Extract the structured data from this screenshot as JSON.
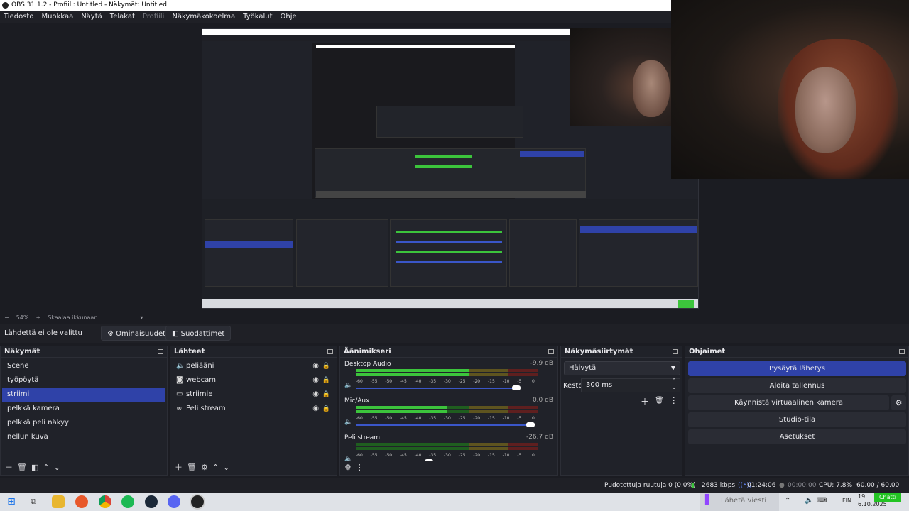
{
  "window": {
    "title": "OBS 31.1.2 - Profiili: Untitled - Näkymät: Untitled"
  },
  "menu": [
    "Tiedosto",
    "Muokkaa",
    "Näytä",
    "Telakat",
    "Profiili",
    "Näkymäkokoelma",
    "Työkalut",
    "Ohje"
  ],
  "preview": {
    "zoom": "54%",
    "scale_mode": "Skaalaa ikkunaan"
  },
  "source_toolbar": {
    "no_source": "Lähdettä ei ole valittu",
    "properties": "Ominaisuudet",
    "filters": "Suodattimet"
  },
  "scenes": {
    "title": "Näkymät",
    "items": [
      "Scene",
      "työpöytä",
      "striimi",
      "pelkkä kamera",
      "pelkkä peli näkyy",
      "nellun kuva"
    ],
    "active_index": 2
  },
  "sources": {
    "title": "Lähteet",
    "items": [
      {
        "name": "peliääni",
        "icon": "speaker-icon"
      },
      {
        "name": "webcam",
        "icon": "camera-icon"
      },
      {
        "name": "striimie",
        "icon": "monitor-icon"
      },
      {
        "name": "Peli stream",
        "icon": "link-icon"
      }
    ]
  },
  "mixer": {
    "title": "Äänimikseri",
    "channels": [
      {
        "name": "Desktop Audio",
        "db": "-9.9 dB",
        "level": 0.62,
        "fader": 0.92
      },
      {
        "name": "Mic/Aux",
        "db": "0.0 dB",
        "level": 0.5,
        "fader": 1.0
      },
      {
        "name": "Peli stream",
        "db": "-26.7 dB",
        "level": 0.0,
        "fader": 0.42
      }
    ],
    "ticks": [
      "-60",
      "-55",
      "-50",
      "-45",
      "-40",
      "-35",
      "-30",
      "-25",
      "-20",
      "-15",
      "-10",
      "-5",
      "0"
    ]
  },
  "transitions": {
    "title": "Näkymäsiirtymät",
    "selected": "Häivytä",
    "duration_label": "Kesto",
    "duration_value": "300 ms"
  },
  "controls": {
    "title": "Ohjaimet",
    "stop_stream": "Pysäytä lähetys",
    "start_recording": "Aloita tallennus",
    "virtual_camera": "Käynnistä virtuaalinen kamera",
    "studio_mode": "Studio-tila",
    "settings": "Asetukset"
  },
  "status": {
    "dropped": "Pudotettuja ruutuja 0 (0.0%)",
    "bitrate": "2683 kbps",
    "stream_time": "01:24:06",
    "rec_time": "00:00:00",
    "cpu": "CPU: 7.8%",
    "fps": "60.00 / 60.00 FPS"
  },
  "taskbar": {
    "chat_placeholder": "Lähetä viesti",
    "chat_button": "Chatti",
    "language": "FIN",
    "time": "19.",
    "date": "6.10.2025"
  },
  "colors": {
    "accent": "#2f42a8",
    "bg": "#1b1c22",
    "panel": "#202229",
    "meter_green": "#3cc43c",
    "meter_yellow": "#c8b43a",
    "meter_red": "#c43a3a"
  }
}
